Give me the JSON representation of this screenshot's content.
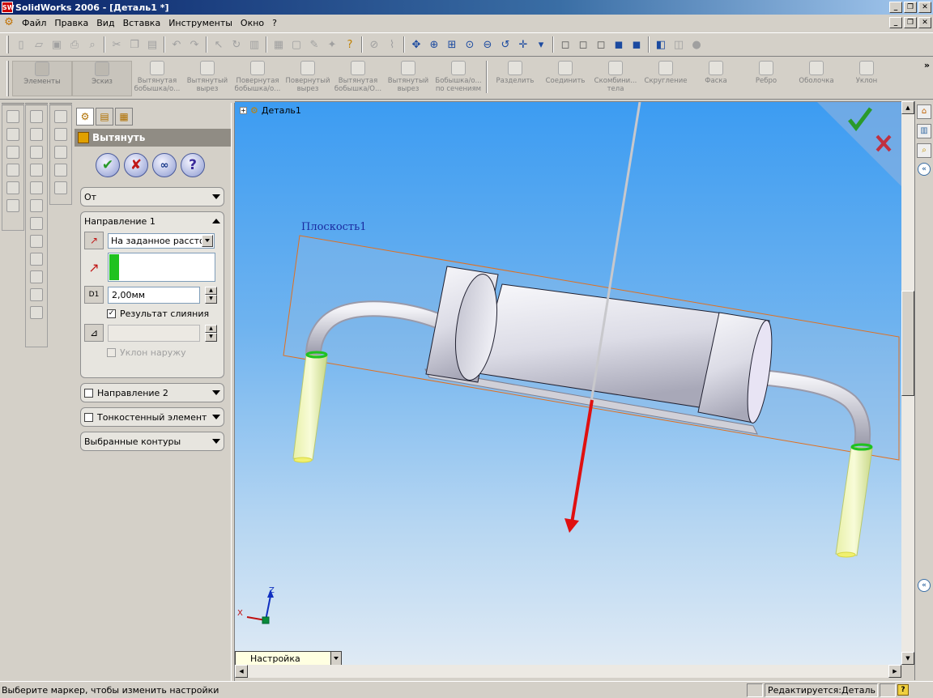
{
  "window": {
    "title": "SolidWorks 2006 - [Деталь1 *]",
    "app_icon": "solidworks-logo-icon",
    "controls": [
      "_",
      "❐",
      "✕"
    ],
    "doc_controls": [
      "_",
      "❐",
      "✕"
    ]
  },
  "menu": [
    "Файл",
    "Правка",
    "Вид",
    "Вставка",
    "Инструменты",
    "Окно",
    "?"
  ],
  "features_toolbar": [
    {
      "label": "Элементы",
      "dropdown": true,
      "big": true
    },
    {
      "label": "Эскиз",
      "dropdown": true,
      "big": true
    },
    {
      "label": "Вытянутая бобышка/о..."
    },
    {
      "label": "Вытянутый вырез"
    },
    {
      "label": "Повернутая бобышка/о..."
    },
    {
      "label": "Повернутый вырез"
    },
    {
      "label": "Вытянутая бобышка/О..."
    },
    {
      "label": "Вытянутый вырез"
    },
    {
      "label": "Бобышка/о... по сечениям"
    },
    {
      "label": "Разделить"
    },
    {
      "label": "Соединить"
    },
    {
      "label": "Скомбини... тела"
    },
    {
      "label": "Скругление"
    },
    {
      "label": "Фаска"
    },
    {
      "label": "Ребро"
    },
    {
      "label": "Оболочка"
    },
    {
      "label": "Уклон"
    }
  ],
  "property_manager": {
    "title": "Вытянуть",
    "from_group": "От",
    "direction1": {
      "title": "Направление 1",
      "end_condition": "На заданное расстояние",
      "depth": "2,00мм",
      "merge_result_label": "Результат слияния",
      "merge_result_checked": true,
      "draft_outward_label": "Уклон наружу",
      "draft_outward_checked": false
    },
    "direction2": {
      "title": "Направление 2",
      "checked": false
    },
    "thin_feature": {
      "title": "Тонкостенный элемент",
      "checked": false
    },
    "selected_contours": {
      "title": "Выбранные контуры"
    }
  },
  "viewport": {
    "tree_root": "Деталь1",
    "plane_label": "Плоскость1",
    "triad": {
      "x": "X",
      "z": "Z"
    },
    "customize_combo": "Настройка",
    "confirm_ok_icon": "checkmark-icon",
    "confirm_cancel_icon": "x-icon"
  },
  "statusbar": {
    "message": "Выберите маркер, чтобы изменить настройки",
    "editing": "Редактируется:Деталь"
  },
  "colors": {
    "title_start": "#0a246a",
    "viewport_top": "#3c9cf2",
    "selection_green": "#1fc21f",
    "direction_arrow": "#e01010",
    "plane_edge": "#e07020"
  }
}
